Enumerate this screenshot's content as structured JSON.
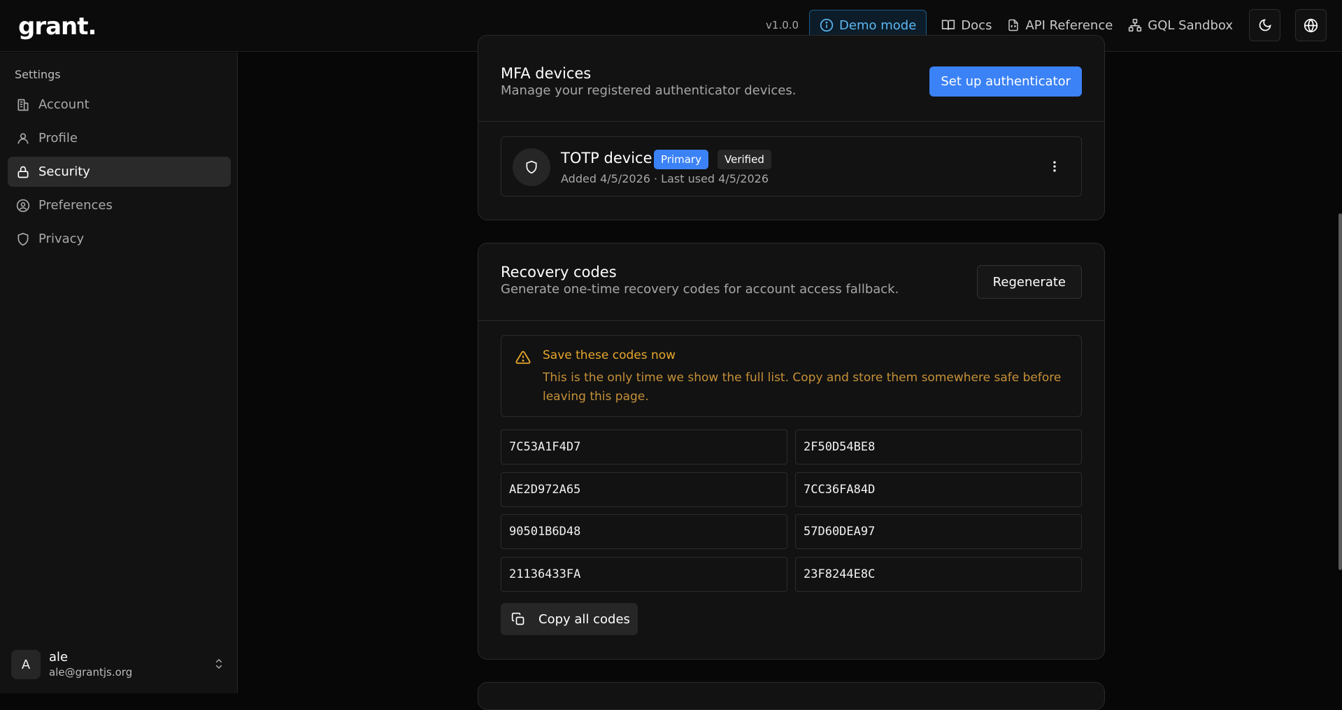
{
  "header": {
    "logo": "grant.",
    "version": "v1.0.0",
    "demo_mode": "Demo mode",
    "links": [
      "Docs",
      "API Reference",
      "GQL Sandbox"
    ]
  },
  "sidebar": {
    "section_title": "Settings",
    "items": [
      {
        "label": "Account",
        "icon": "building-icon",
        "active": false
      },
      {
        "label": "Profile",
        "icon": "user-icon",
        "active": false
      },
      {
        "label": "Security",
        "icon": "lock-icon",
        "active": true
      },
      {
        "label": "Preferences",
        "icon": "user-circle-icon",
        "active": false
      },
      {
        "label": "Privacy",
        "icon": "shield-icon",
        "active": false
      }
    ],
    "user": {
      "initial": "A",
      "name": "ale",
      "email": "ale@grantjs.org"
    }
  },
  "mfa": {
    "title": "MFA devices",
    "subtitle": "Manage your registered authenticator devices.",
    "setup_button": "Set up authenticator",
    "device": {
      "name": "TOTP device",
      "badge_primary": "Primary",
      "badge_verified": "Verified",
      "meta": "Added 4/5/2026 · Last used 4/5/2026"
    }
  },
  "recovery": {
    "title": "Recovery codes",
    "subtitle": "Generate one-time recovery codes for account access fallback.",
    "regenerate_button": "Regenerate",
    "warning_title": "Save these codes now",
    "warning_body": "This is the only time we show the full list. Copy and store them somewhere safe before leaving this page.",
    "codes": [
      "7C53A1F4D7",
      "2F50D54BE8",
      "AE2D972A65",
      "7CC36FA84D",
      "90501B6D48",
      "57D60DEA97",
      "21136433FA",
      "23F8244E8C"
    ],
    "copy_button": "Copy all codes"
  },
  "colors": {
    "accent": "#3b82f6",
    "warning": "#e7a72c",
    "demo": "#5db8f2"
  }
}
